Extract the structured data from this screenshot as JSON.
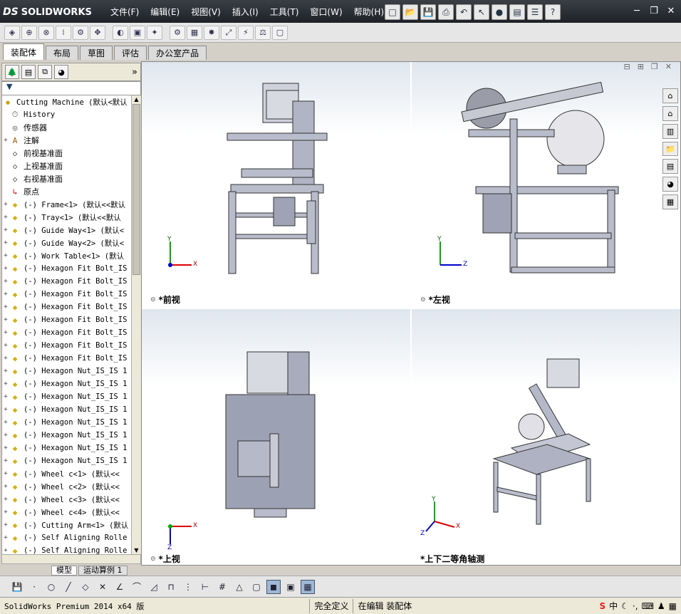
{
  "app": {
    "logo_text": "SOLIDWORKS",
    "logo_mark": "DS"
  },
  "menu": [
    "文件(F)",
    "编辑(E)",
    "视图(V)",
    "插入(I)",
    "工具(T)",
    "窗口(W)",
    "帮助(H)"
  ],
  "command_tabs": [
    "装配体",
    "布局",
    "草图",
    "评估",
    "办公室产品"
  ],
  "active_tab": "装配体",
  "feature_tree": {
    "root": "Cutting Machine  (默认<默认",
    "items": [
      {
        "label": "History",
        "icon": "history-icon",
        "expand": "",
        "mono": true
      },
      {
        "label": "传感器",
        "icon": "sensor-icon",
        "expand": ""
      },
      {
        "label": "注解",
        "icon": "annotation-icon",
        "expand": "+"
      },
      {
        "label": "前视基准面",
        "icon": "plane-icon",
        "expand": ""
      },
      {
        "label": "上视基准面",
        "icon": "plane-icon",
        "expand": ""
      },
      {
        "label": "右视基准面",
        "icon": "plane-icon",
        "expand": ""
      },
      {
        "label": "原点",
        "icon": "origin-icon",
        "expand": ""
      },
      {
        "label": "(-) Frame<1> (默认<<默认",
        "icon": "part-icon",
        "expand": "+",
        "mono": true
      },
      {
        "label": "(-) Tray<1> (默认<<默认",
        "icon": "part-icon",
        "expand": "+",
        "mono": true
      },
      {
        "label": "(-) Guide Way<1> (默认<",
        "icon": "part-icon",
        "expand": "+",
        "mono": true
      },
      {
        "label": "(-) Guide Way<2> (默认<",
        "icon": "part-icon",
        "expand": "+",
        "mono": true
      },
      {
        "label": "(-) Work Table<1> (默认",
        "icon": "part-icon",
        "expand": "+",
        "mono": true
      },
      {
        "label": "(-) Hexagon Fit Bolt_IS",
        "icon": "part-icon",
        "expand": "+",
        "mono": true
      },
      {
        "label": "(-) Hexagon Fit Bolt_IS",
        "icon": "part-icon",
        "expand": "+",
        "mono": true
      },
      {
        "label": "(-) Hexagon Fit Bolt_IS",
        "icon": "part-icon",
        "expand": "+",
        "mono": true
      },
      {
        "label": "(-) Hexagon Fit Bolt_IS",
        "icon": "part-icon",
        "expand": "+",
        "mono": true
      },
      {
        "label": "(-) Hexagon Fit Bolt_IS",
        "icon": "part-icon",
        "expand": "+",
        "mono": true
      },
      {
        "label": "(-) Hexagon Fit Bolt_IS",
        "icon": "part-icon",
        "expand": "+",
        "mono": true
      },
      {
        "label": "(-) Hexagon Fit Bolt_IS",
        "icon": "part-icon",
        "expand": "+",
        "mono": true
      },
      {
        "label": "(-) Hexagon Fit Bolt_IS",
        "icon": "part-icon",
        "expand": "+",
        "mono": true
      },
      {
        "label": "(-) Hexagon Nut_IS_IS 1",
        "icon": "part-icon",
        "expand": "+",
        "mono": true
      },
      {
        "label": "(-) Hexagon Nut_IS_IS 1",
        "icon": "part-icon",
        "expand": "+",
        "mono": true
      },
      {
        "label": "(-) Hexagon Nut_IS_IS 1",
        "icon": "part-icon",
        "expand": "+",
        "mono": true
      },
      {
        "label": "(-) Hexagon Nut_IS_IS 1",
        "icon": "part-icon",
        "expand": "+",
        "mono": true
      },
      {
        "label": "(-) Hexagon Nut_IS_IS 1",
        "icon": "part-icon",
        "expand": "+",
        "mono": true
      },
      {
        "label": "(-) Hexagon Nut_IS_IS 1",
        "icon": "part-icon",
        "expand": "+",
        "mono": true
      },
      {
        "label": "(-) Hexagon Nut_IS_IS 1",
        "icon": "part-icon",
        "expand": "+",
        "mono": true
      },
      {
        "label": "(-) Hexagon Nut_IS_IS 1",
        "icon": "part-icon",
        "expand": "+",
        "mono": true
      },
      {
        "label": "(-) Wheel c<1> (默认<<",
        "icon": "part-icon",
        "expand": "+",
        "mono": true
      },
      {
        "label": "(-) Wheel c<2> (默认<<",
        "icon": "part-icon",
        "expand": "+",
        "mono": true
      },
      {
        "label": "(-) Wheel c<3> (默认<<",
        "icon": "part-icon",
        "expand": "+",
        "mono": true
      },
      {
        "label": "(-) Wheel c<4> (默认<<",
        "icon": "part-icon",
        "expand": "+",
        "mono": true
      },
      {
        "label": "(-) Cutting Arm<1> (默认",
        "icon": "part-icon",
        "expand": "+",
        "mono": true
      },
      {
        "label": "(-) Self Aligning Rolle",
        "icon": "part-icon",
        "expand": "+",
        "mono": true
      },
      {
        "label": "(-) Self Aligning Rolle",
        "icon": "part-icon",
        "expand": "+",
        "mono": true
      }
    ]
  },
  "bottom_tabs": [
    "模型",
    "运动算例 1"
  ],
  "views": {
    "front": "*前视",
    "left": "*左视",
    "top": "*上视",
    "iso": "*上下二等角轴测"
  },
  "axes": {
    "x": "X",
    "y": "Y",
    "z": "Z"
  },
  "status": {
    "product": "SolidWorks Premium 2014 x64 版",
    "state": "完全定义",
    "mode": "在编辑 装配体",
    "ime_text": "中"
  },
  "colors": {
    "accent": "#1e2227",
    "part_yellow": "#e8c200",
    "model_gray": "#a8a8b8"
  }
}
